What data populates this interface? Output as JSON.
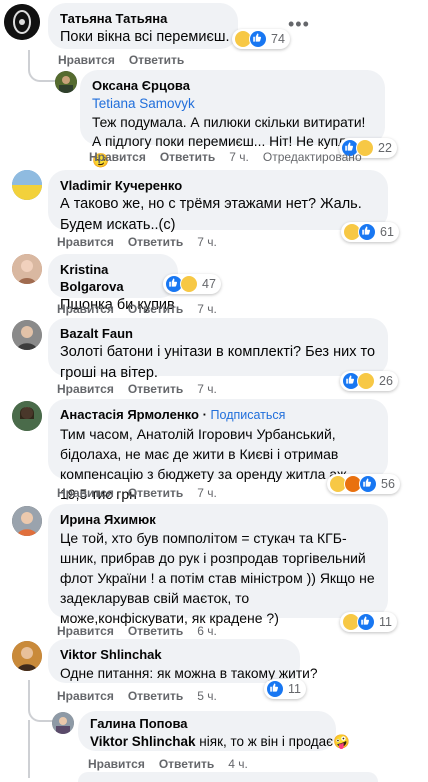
{
  "actions": {
    "like": "Нравится",
    "reply": "Ответить",
    "edited": "Отредактировано"
  },
  "comments": [
    {
      "name": "Татьяна Татьяна",
      "text": "Поки вікна всі перемиєш...🤦",
      "reactions": "74",
      "time": ""
    },
    {
      "name": "Оксана Єрцова",
      "mention": "Tetiana Samovyk",
      "text": "Теж подумала. А пилюки скільки витирати! А підлогу поки перемиєш... Ніт! Не куплю 😏",
      "reactions": "22",
      "time": "7 ч."
    },
    {
      "name": "Vladimir Кучеренко",
      "text": "А таково же, но с трёмя этажами нет? Жаль. Будем искать..(с)",
      "reactions": "61",
      "time": "7 ч."
    },
    {
      "name": "Kristina Bolgarova",
      "text": "Пшонка би купив",
      "reactions": "47",
      "time": "7 ч."
    },
    {
      "name": "Bazalt Faun",
      "text": "Золоті батони і унітази в комплекті? Без них то гроші на вітер.",
      "reactions": "26",
      "time": "7 ч."
    },
    {
      "name": "Анастасія Ярмоленко",
      "follow": "Подписаться",
      "text": "Тим часом, Анатолій Ігорович Урбанський, бідолаха, не має де жити в Києві і отримав компенсацію з бюджету за оренду житла аж 19,5 тис грн",
      "reactions": "56",
      "time": "7 ч."
    },
    {
      "name": "Ирина Яхимюк",
      "text": "Це той, хто був помполітом = стукач та КГБ-шник, прибрав до рук і розпродав торгівельний флот України ! а потім став міністром )) Якщо не задекларував свій маєток, то може,конфіскувати, як крадене ?)",
      "reactions": "11",
      "time": "6 ч."
    },
    {
      "name": "Viktor Shlinchak",
      "text": "Одне питання: як можна в такому жити?",
      "reactions": "11",
      "time": "5 ч."
    },
    {
      "name": "Галина Попова",
      "mention": "Viktor Shlinchak",
      "text": " ніяк, то ж він і продає🤪",
      "time": "4 ч."
    }
  ],
  "colors": {
    "accent": "#216fdb",
    "bubble": "#f0f2f5",
    "meta": "#65676b"
  },
  "icons": [
    "more-icon",
    "like-icon",
    "haha-icon",
    "wow-icon",
    "angry-icon"
  ]
}
